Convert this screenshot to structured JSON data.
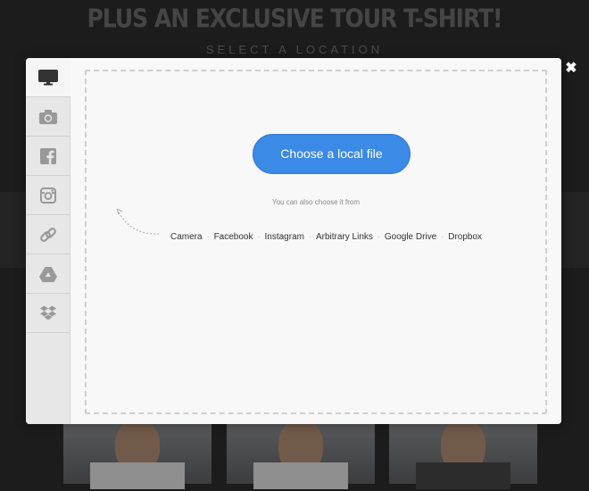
{
  "background": {
    "headline": "PLUS AN EXCLUSIVE TOUR T-SHIRT!",
    "subheadline": "SELECT A LOCATION"
  },
  "modal": {
    "close_icon": "close-icon",
    "sidebar": [
      {
        "id": "computer",
        "icon": "monitor-icon",
        "active": true
      },
      {
        "id": "camera",
        "icon": "camera-icon"
      },
      {
        "id": "facebook",
        "icon": "facebook-icon"
      },
      {
        "id": "instagram",
        "icon": "instagram-icon"
      },
      {
        "id": "link",
        "icon": "link-icon"
      },
      {
        "id": "google-drive",
        "icon": "google-drive-icon"
      },
      {
        "id": "dropbox",
        "icon": "dropbox-icon"
      }
    ],
    "choose_button": "Choose a local file",
    "also_text": "You can also choose it from",
    "sources": [
      "Camera",
      "Facebook",
      "Instagram",
      "Arbitrary Links",
      "Google Drive",
      "Dropbox"
    ]
  }
}
